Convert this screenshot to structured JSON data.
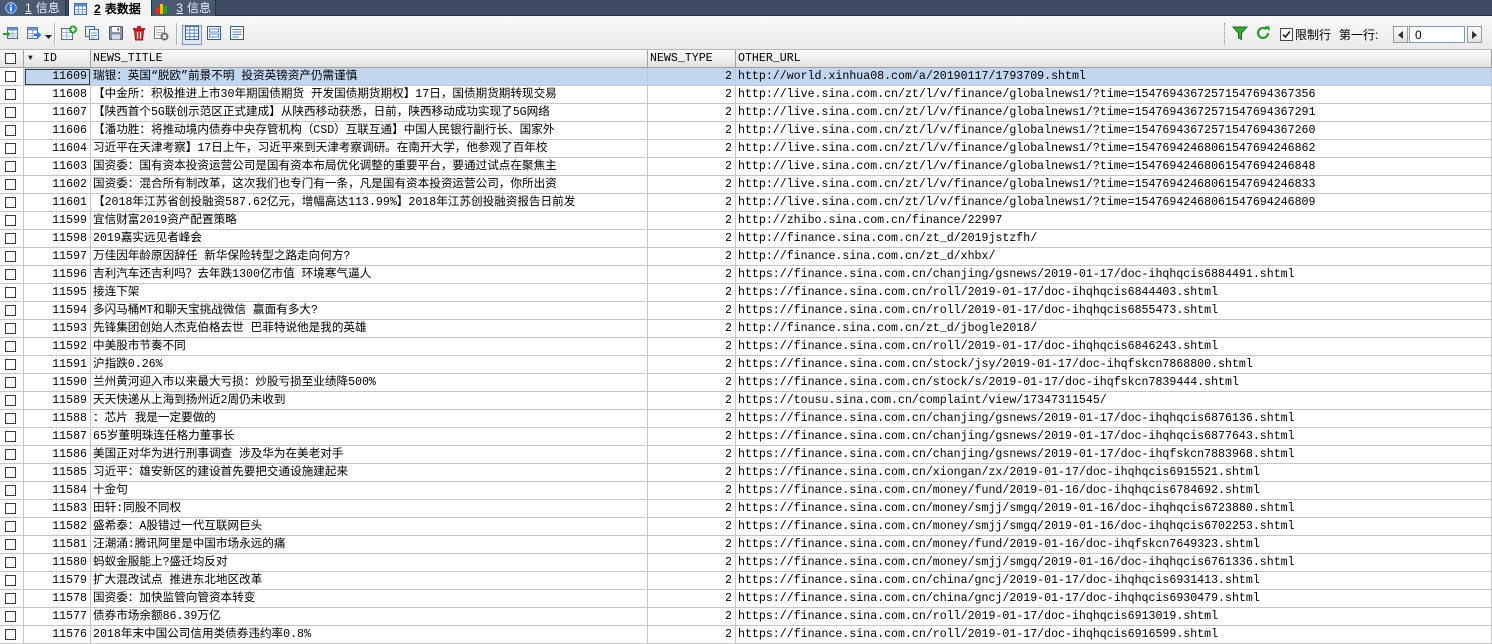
{
  "tabs": [
    {
      "number": "1",
      "label": "信息",
      "icon": "info-icon",
      "active": false
    },
    {
      "number": "2",
      "label": "表数据",
      "icon": "table-icon",
      "active": true
    },
    {
      "number": "3",
      "label": "信息",
      "icon": "chart-icon",
      "active": false
    }
  ],
  "toolbar": {
    "left_icons": [
      "export-icon",
      "import-icon",
      "chevron-down-icon",
      "add-row-icon",
      "duplicate-row-icon",
      "save-icon",
      "delete-icon",
      "cancel-icon",
      "grid-view-icon",
      "form-view-icon",
      "text-view-icon"
    ],
    "active_view_icon": "grid-view-icon",
    "right_icons": [
      "filter-icon",
      "refresh-icon"
    ],
    "limit_rows_label": "限制行",
    "limit_rows_checked": true,
    "first_row_label": "第一行:",
    "first_row_value": "0"
  },
  "table": {
    "columns": [
      "ID",
      "NEWS_TITLE",
      "NEWS_TYPE",
      "OTHER_URL"
    ],
    "sort_icon": "sort-desc-icon",
    "rows": [
      {
        "id": 11609,
        "title": "瑞银：英国“脱欧”前景不明 投资英镑资产仍需谨慎",
        "type": 2,
        "url": "http://world.xinhua08.com/a/20190117/1793709.shtml",
        "selected": true
      },
      {
        "id": 11608,
        "title": "【中金所：积极推进上市30年期国债期货 开发国债期货期权】17日，国债期货期转现交易",
        "type": 2,
        "url": "http://live.sina.com.cn/zt/l/v/finance/globalnews1/?time=15476943672571547694367356"
      },
      {
        "id": 11607,
        "title": "【陕西首个5G联创示范区正式建成】从陕西移动获悉，日前，陕西移动成功实现了5G网络",
        "type": 2,
        "url": "http://live.sina.com.cn/zt/l/v/finance/globalnews1/?time=15476943672571547694367291"
      },
      {
        "id": 11606,
        "title": "【潘功胜：将推动境内债券中央存管机构（CSD）互联互通】中国人民银行副行长、国家外",
        "type": 2,
        "url": "http://live.sina.com.cn/zt/l/v/finance/globalnews1/?time=15476943672571547694367260"
      },
      {
        "id": 11604,
        "title": "习近平在天津考察】17日上午，习近平来到天津考察调研。在南开大学，他参观了百年校",
        "type": 2,
        "url": "http://live.sina.com.cn/zt/l/v/finance/globalnews1/?time=15476942468061547694246862"
      },
      {
        "id": 11603,
        "title": "国资委：国有资本投资运营公司是国有资本布局优化调整的重要平台，要通过试点在聚焦主",
        "type": 2,
        "url": "http://live.sina.com.cn/zt/l/v/finance/globalnews1/?time=15476942468061547694246848"
      },
      {
        "id": 11602,
        "title": "国资委：混合所有制改革，这次我们也专门有一条，凡是国有资本投资运营公司，你所出资",
        "type": 2,
        "url": "http://live.sina.com.cn/zt/l/v/finance/globalnews1/?time=15476942468061547694246833"
      },
      {
        "id": 11601,
        "title": "【2018年江苏省创投融资587.62亿元，增幅高达113.99%】2018年江苏创投融资报告日前发",
        "type": 2,
        "url": "http://live.sina.com.cn/zt/l/v/finance/globalnews1/?time=15476942468061547694246809"
      },
      {
        "id": 11599,
        "title": "宜信财富2019资产配置策略",
        "type": 2,
        "url": "http://zhibo.sina.com.cn/finance/22997"
      },
      {
        "id": 11598,
        "title": "2019嘉实远见者峰会",
        "type": 2,
        "url": "http://finance.sina.com.cn/zt_d/2019jstzfh/"
      },
      {
        "id": 11597,
        "title": "万佳因年龄原因辞任 新华保险转型之路走向何方?",
        "type": 2,
        "url": "http://finance.sina.com.cn/zt_d/xhbx/"
      },
      {
        "id": 11596,
        "title": "吉利汽车还吉利吗？去年跌1300亿市值 环境寒气逼人",
        "type": 2,
        "url": "https://finance.sina.com.cn/chanjing/gsnews/2019-01-17/doc-ihqhqcis6884491.shtml"
      },
      {
        "id": 11595,
        "title": "接连下架",
        "type": 2,
        "url": "https://finance.sina.com.cn/roll/2019-01-17/doc-ihqhqcis6844403.shtml"
      },
      {
        "id": 11594,
        "title": "多闪马桶MT和聊天宝挑战微信 赢面有多大?",
        "type": 2,
        "url": "https://finance.sina.com.cn/roll/2019-01-17/doc-ihqhqcis6855473.shtml"
      },
      {
        "id": 11593,
        "title": "先锋集团创始人杰克伯格去世 巴菲特说他是我的英雄",
        "type": 2,
        "url": "http://finance.sina.com.cn/zt_d/jbogle2018/"
      },
      {
        "id": 11592,
        "title": "中美股市节奏不同",
        "type": 2,
        "url": "https://finance.sina.com.cn/roll/2019-01-17/doc-ihqhqcis6846243.shtml"
      },
      {
        "id": 11591,
        "title": "沪指跌0.26%",
        "type": 2,
        "url": "https://finance.sina.com.cn/stock/jsy/2019-01-17/doc-ihqfskcn7868800.shtml"
      },
      {
        "id": 11590,
        "title": "兰州黄河迎入市以来最大亏损：炒股亏损至业绩降500%",
        "type": 2,
        "url": "https://finance.sina.com.cn/stock/s/2019-01-17/doc-ihqfskcn7839444.shtml"
      },
      {
        "id": 11589,
        "title": "天天快递从上海到扬州近2周仍未收到",
        "type": 2,
        "url": "https://tousu.sina.com.cn/complaint/view/17347311545/"
      },
      {
        "id": 11588,
        "title": "：芯片 我是一定要做的",
        "type": 2,
        "url": "https://finance.sina.com.cn/chanjing/gsnews/2019-01-17/doc-ihqhqcis6876136.shtml"
      },
      {
        "id": 11587,
        "title": "65岁董明珠连任格力董事长",
        "type": 2,
        "url": "https://finance.sina.com.cn/chanjing/gsnews/2019-01-17/doc-ihqhqcis6877643.shtml"
      },
      {
        "id": 11586,
        "title": "美国正对华为进行刑事调查 涉及华为在美老对手",
        "type": 2,
        "url": "https://finance.sina.com.cn/chanjing/gsnews/2019-01-17/doc-ihqfskcn7883968.shtml"
      },
      {
        "id": 11585,
        "title": "习近平：雄安新区的建设首先要把交通设施建起来",
        "type": 2,
        "url": "https://finance.sina.com.cn/xiongan/zx/2019-01-17/doc-ihqhqcis6915521.shtml"
      },
      {
        "id": 11584,
        "title": "十金句",
        "type": 2,
        "url": "https://finance.sina.com.cn/money/fund/2019-01-16/doc-ihqhqcis6784692.shtml"
      },
      {
        "id": 11583,
        "title": "田轩:同股不同权",
        "type": 2,
        "url": "https://finance.sina.com.cn/money/smjj/smgq/2019-01-16/doc-ihqhqcis6723880.shtml"
      },
      {
        "id": 11582,
        "title": "盛希泰：A股错过一代互联网巨头",
        "type": 2,
        "url": "https://finance.sina.com.cn/money/smjj/smgq/2019-01-16/doc-ihqhqcis6702253.shtml"
      },
      {
        "id": 11581,
        "title": "汪潮涌:腾讯阿里是中国市场永远的痛",
        "type": 2,
        "url": "https://finance.sina.com.cn/money/fund/2019-01-16/doc-ihqfskcn7649323.shtml"
      },
      {
        "id": 11580,
        "title": "蚂蚁金服能上?盛迁均反对",
        "type": 2,
        "url": "https://finance.sina.com.cn/money/smjj/smgq/2019-01-16/doc-ihqhqcis6761336.shtml"
      },
      {
        "id": 11579,
        "title": "扩大混改试点 推进东北地区改革",
        "type": 2,
        "url": "https://finance.sina.com.cn/china/gncj/2019-01-17/doc-ihqhqcis6931413.shtml"
      },
      {
        "id": 11578,
        "title": "国资委：加快监管向管资本转变",
        "type": 2,
        "url": "https://finance.sina.com.cn/china/gncj/2019-01-17/doc-ihqhqcis6930479.shtml"
      },
      {
        "id": 11577,
        "title": "债券市场余额86.39万亿",
        "type": 2,
        "url": "https://finance.sina.com.cn/roll/2019-01-17/doc-ihqhqcis6913019.shtml"
      },
      {
        "id": 11576,
        "title": "2018年末中国公司信用类债券违约率0.8%",
        "type": 2,
        "url": "https://finance.sina.com.cn/roll/2019-01-17/doc-ihqhqcis6916599.shtml"
      }
    ]
  },
  "colors": {
    "tabbar": "#3e4b62",
    "selected_row": "#c3d6ef",
    "grid_line": "#c6c6c6"
  }
}
